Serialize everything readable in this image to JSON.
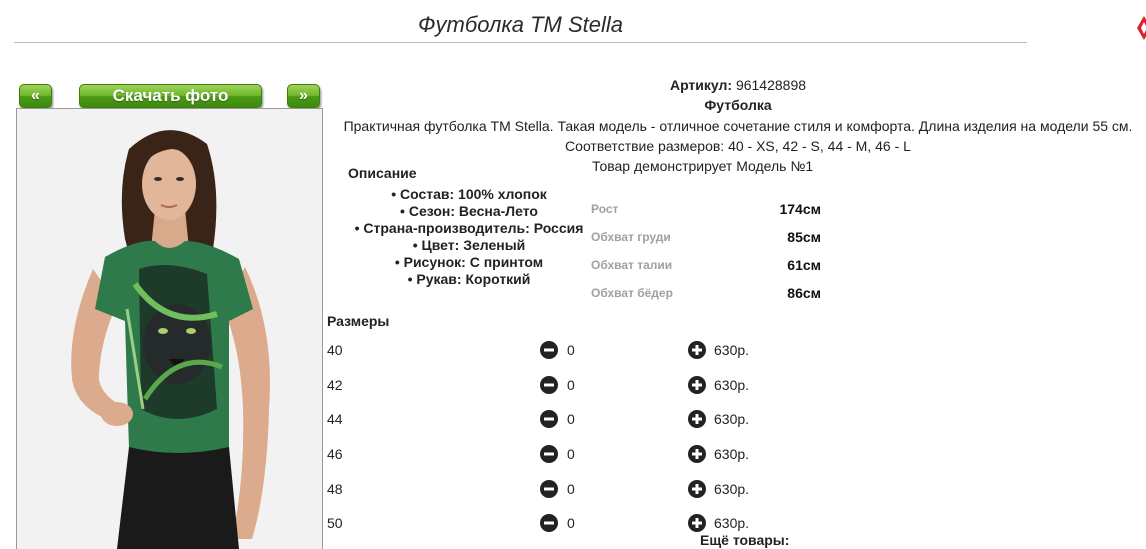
{
  "page": {
    "title": "Футболка TM Stella"
  },
  "gallery": {
    "prev_label": "«",
    "download_label": "Скачать фото",
    "next_label": "»"
  },
  "product": {
    "article_label": "Артикул:",
    "article_value": "961428898",
    "type": "Футболка",
    "description": "Практичная футболка TM Stella. Такая модель - отличное сочетание стиля и комфорта. Длина изделия на модели 55 см.",
    "size_correspondence": "Соответствие размеров: 40 - XS, 42 - S, 44 - M, 46 - L"
  },
  "details": {
    "heading": "Описание",
    "features": [
      "Состав: 100% хлопок",
      "Сезон: Весна-Лето",
      "Страна-производитель: Россия",
      "Цвет: Зеленый",
      "Рисунок: С принтом",
      "Рукав: Короткий"
    ]
  },
  "model": {
    "demo_text": "Товар демонстрирует Модель №1",
    "measurements": [
      {
        "label": "Рост",
        "value": "174см"
      },
      {
        "label": "Обхват груди",
        "value": "85см"
      },
      {
        "label": "Обхват талии",
        "value": "61см"
      },
      {
        "label": "Обхват бёдер",
        "value": "86см"
      }
    ]
  },
  "sizes": {
    "heading": "Размеры",
    "rows": [
      {
        "size": "40",
        "qty": "0",
        "price": "630р."
      },
      {
        "size": "42",
        "qty": "0",
        "price": "630р."
      },
      {
        "size": "44",
        "qty": "0",
        "price": "630р."
      },
      {
        "size": "46",
        "qty": "0",
        "price": "630р."
      },
      {
        "size": "48",
        "qty": "0",
        "price": "630р."
      },
      {
        "size": "50",
        "qty": "0",
        "price": "630р."
      }
    ]
  },
  "more_products": "Ещё товары:",
  "icons": {
    "minus": "minus-circle-icon",
    "plus": "plus-circle-icon"
  },
  "colors": {
    "button_green": "#5aa81e",
    "shirt_green": "#2f7a4a",
    "icon_dark": "#222222"
  }
}
